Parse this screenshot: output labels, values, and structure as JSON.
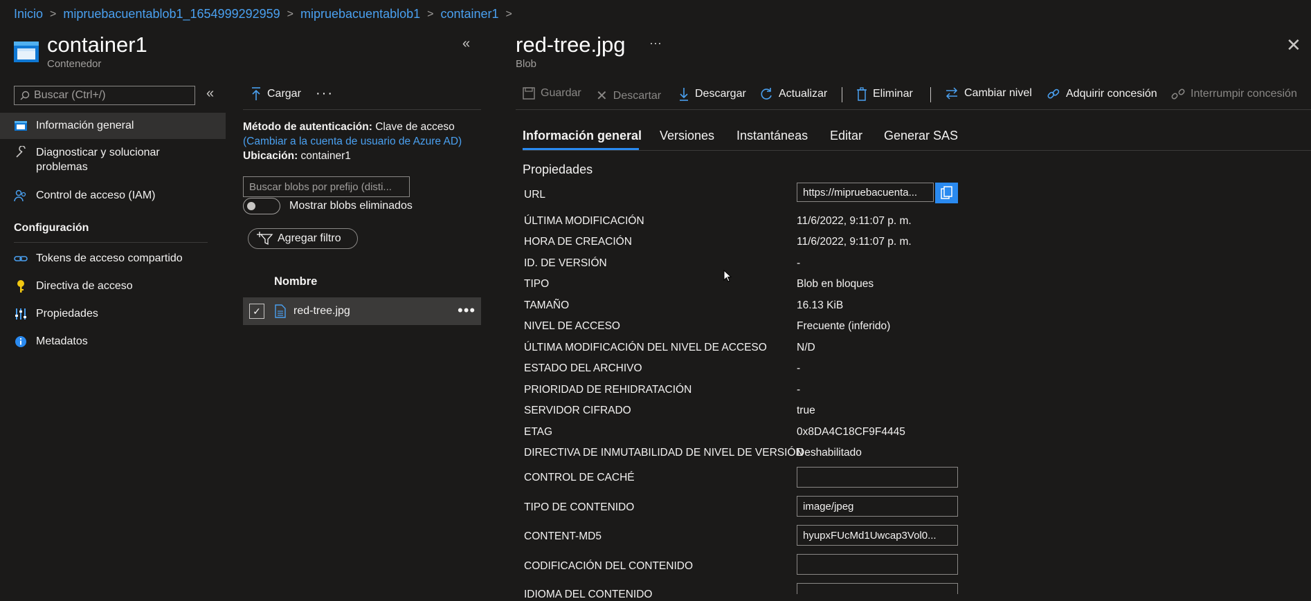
{
  "breadcrumb": [
    "Inicio",
    "mipruebacuentablob1_1654999292959",
    "mipruebacuentablob1",
    "container1"
  ],
  "left_blade": {
    "title": "container1",
    "subtitle": "Contenedor",
    "search_placeholder": "Buscar (Ctrl+/)",
    "nav": [
      {
        "label": "Información general",
        "icon": "container-icon"
      },
      {
        "label": "Diagnosticar y solucionar\nproblemas",
        "icon": "wrench-icon"
      },
      {
        "label": "Control de acceso (IAM)",
        "icon": "people-icon"
      }
    ],
    "section_config": "Configuración",
    "config_nav": [
      {
        "label": "Tokens de acceso compartido",
        "icon": "link-icon"
      },
      {
        "label": "Directiva de acceso",
        "icon": "key-icon"
      },
      {
        "label": "Propiedades",
        "icon": "sliders-icon"
      },
      {
        "label": "Metadatos",
        "icon": "info-icon"
      }
    ]
  },
  "middle": {
    "upload_label": "Cargar",
    "auth_label": "Método de autenticación:",
    "auth_value": "Clave de acceso",
    "auth_link": "(Cambiar a la cuenta de usuario de Azure AD)",
    "location_label": "Ubicación:",
    "location_value": "container1",
    "search_placeholder": "Buscar blobs por prefijo (disti...",
    "toggle_label": "Mostrar blobs eliminados",
    "filter_label": "Agregar filtro",
    "column_name": "Nombre",
    "file_name": "red-tree.jpg"
  },
  "detail": {
    "title": "red-tree.jpg",
    "subtitle": "Blob",
    "toolbar": {
      "save": "Guardar",
      "discard": "Descartar",
      "download": "Descargar",
      "refresh": "Actualizar",
      "delete": "Eliminar",
      "change_tier": "Cambiar nivel",
      "acquire_lease": "Adquirir concesión",
      "break_lease": "Interrumpir concesión"
    },
    "tabs": [
      "Información general",
      "Versiones",
      "Instantáneas",
      "Editar",
      "Generar SAS"
    ],
    "section_title": "Propiedades",
    "props": {
      "url_label": "URL",
      "url_value": "https://mipruebacuenta...",
      "last_modified_label": "ÚLTIMA MODIFICACIÓN",
      "last_modified": "11/6/2022, 9:11:07 p. m.",
      "created_label": "HORA DE CREACIÓN",
      "created": "11/6/2022, 9:11:07 p. m.",
      "version_label": "ID. DE VERSIÓN",
      "version": "-",
      "type_label": "TIPO",
      "type": "Blob en bloques",
      "size_label": "TAMAÑO",
      "size": "16.13 KiB",
      "tier_label": "NIVEL DE ACCESO",
      "tier": "Frecuente (inferido)",
      "tier_modified_label": "ÚLTIMA MODIFICACIÓN DEL NIVEL DE ACCESO",
      "tier_modified": "N/D",
      "archive_label": "ESTADO DEL ARCHIVO",
      "archive": "-",
      "rehydrate_label": "PRIORIDAD DE REHIDRATACIÓN",
      "rehydrate": "-",
      "encrypted_label": "SERVIDOR CIFRADO",
      "encrypted": "true",
      "etag_label": "ETAG",
      "etag": "0x8DA4C18CF9F4445",
      "immutability_label": "DIRECTIVA DE INMUTABILIDAD DE NIVEL DE VERSIÓN",
      "immutability": "Deshabilitado",
      "cache_label": "CONTROL DE CACHÉ",
      "cache": "",
      "content_type_label": "TIPO DE CONTENIDO",
      "content_type": "image/jpeg",
      "md5_label": "CONTENT-MD5",
      "md5": "hyupxFUcMd1Uwcap3Vol0...",
      "encoding_label": "CODIFICACIÓN DEL CONTENIDO",
      "encoding": "",
      "language_label": "IDIOMA DEL CONTENIDO"
    }
  },
  "colors": {
    "accent": "#4aa0f0",
    "background": "#1b1a19",
    "selected": "#323130",
    "copy_button": "#2a8af0"
  }
}
